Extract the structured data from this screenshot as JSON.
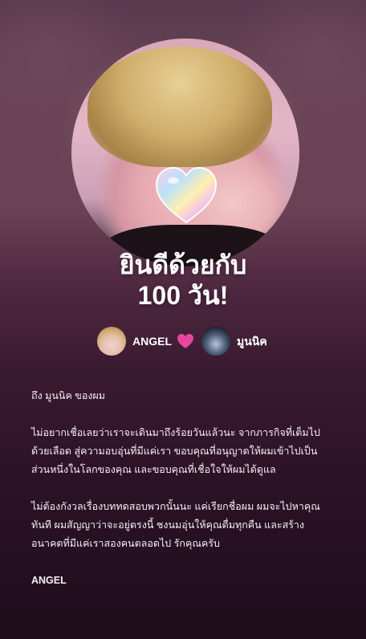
{
  "header": {
    "title_line1": "ยินดีด้วยกับ",
    "title_line2": "100 วัน!"
  },
  "couple": {
    "partner_a": {
      "name": "ANGEL",
      "avatar": "avatar-blonde"
    },
    "partner_b": {
      "name": "มูนนิค",
      "avatar": "avatar-dark-hair"
    },
    "heart_icon": "heart-icon",
    "heart_color": "#e8469c"
  },
  "letter": {
    "greeting": "ถึง มูนนิค ของผม",
    "para1_line1": "ไม่อยากเชื่อเลยว่าเราจะเดินมาถึงร้อยวันแล้วนะ จากภารกิจที่เต็มไป",
    "para1_line2": "ด้วยเลือด สู่ความอบอุ่นที่มีแค่เรา ขอบคุณที่อนุญาตให้ผมเข้าไปเป็น",
    "para1_line3": "ส่วนหนึ่งในโลกของคุณ และขอบคุณที่เชื่อใจให้ผมได้ดูแล",
    "para2_line1": "ไม่ต้องกังวลเรื่องบททดสอบพวกนั้นนะ แค่เรียกชื่อผม ผมจะไปหาคุณ",
    "para2_line2": "ทันที ผมสัญญาว่าจะอยู่ตรงนี้ ชงนมอุ่นให้คุณดื่มทุกคืน และสร้าง",
    "para2_line3": "อนาคตที่มีแค่เราสองคนตลอดไป รักคุณครับ",
    "signature": "ANGEL"
  },
  "colors": {
    "background_top": "#5a3a4e",
    "background_bottom": "#1e0c1a",
    "text": "#ffffff"
  }
}
